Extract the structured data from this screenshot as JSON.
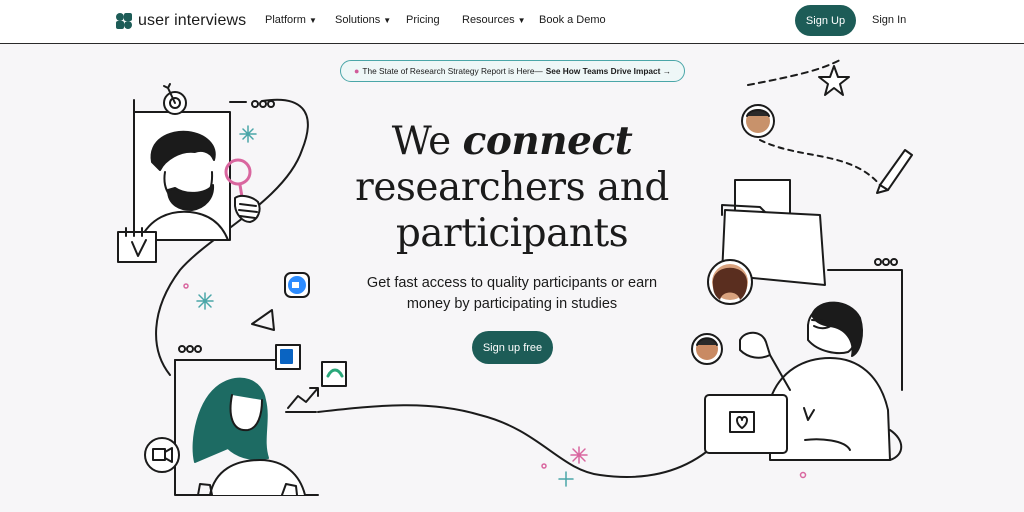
{
  "brand": {
    "name": "user interviews",
    "color": "#1d5c57"
  },
  "nav": {
    "items": [
      {
        "label": "Platform",
        "has_dropdown": true
      },
      {
        "label": "Solutions",
        "has_dropdown": true
      },
      {
        "label": "Pricing",
        "has_dropdown": false
      },
      {
        "label": "Resources",
        "has_dropdown": true
      },
      {
        "label": "Book a Demo",
        "has_dropdown": false
      }
    ],
    "signup_label": "Sign Up",
    "signin_label": "Sign In"
  },
  "banner": {
    "icon": "brain-icon",
    "text": "The State of Research Strategy Report is Here—",
    "link": "See How Teams Drive Impact →"
  },
  "hero": {
    "line1_a": "We",
    "line1_b": "connect",
    "line2": "researchers and",
    "line3": "participants",
    "subtitle_1": "Get fast access to quality participants or earn",
    "subtitle_2": "money by participating in studies",
    "cta_label": "Sign up free"
  }
}
